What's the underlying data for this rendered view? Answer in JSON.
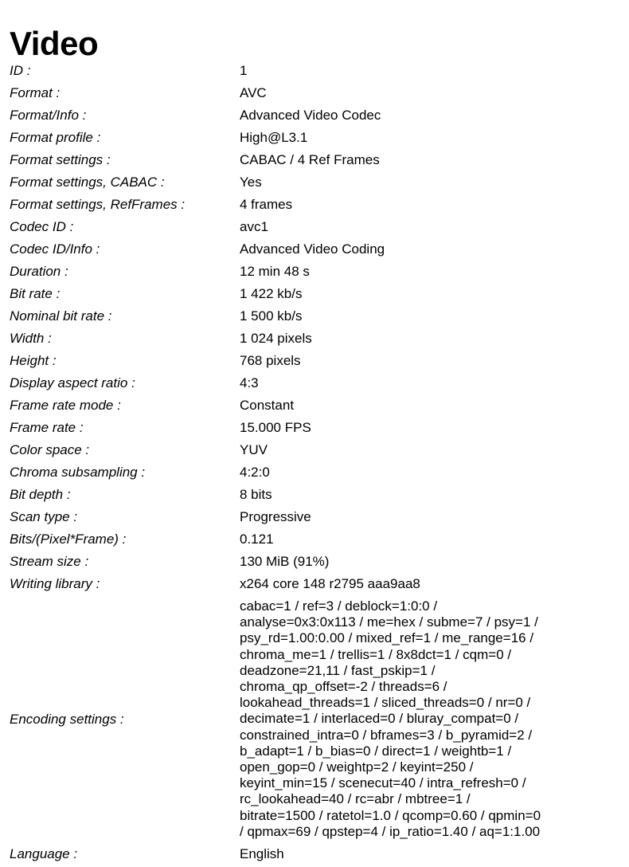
{
  "document": {
    "section_title": "Video"
  },
  "properties": [
    {
      "label": "ID :",
      "value": "1"
    },
    {
      "label": "Format :",
      "value": "AVC"
    },
    {
      "label": "Format/Info :",
      "value": "Advanced Video Codec"
    },
    {
      "label": "Format profile :",
      "value": "High@L3.1"
    },
    {
      "label": "Format settings :",
      "value": "CABAC / 4 Ref Frames"
    },
    {
      "label": "Format settings, CABAC :",
      "value": "Yes"
    },
    {
      "label": "Format settings, RefFrames :",
      "value": "4 frames"
    },
    {
      "label": "Codec ID :",
      "value": "avc1"
    },
    {
      "label": "Codec ID/Info :",
      "value": "Advanced Video Coding"
    },
    {
      "label": "Duration :",
      "value": "12 min 48 s"
    },
    {
      "label": "Bit rate :",
      "value": "1 422 kb/s"
    },
    {
      "label": "Nominal bit rate :",
      "value": "1 500 kb/s"
    },
    {
      "label": "Width :",
      "value": "1 024 pixels"
    },
    {
      "label": "Height :",
      "value": "768 pixels"
    },
    {
      "label": "Display aspect ratio :",
      "value": "4:3"
    },
    {
      "label": "Frame rate mode :",
      "value": "Constant"
    },
    {
      "label": "Frame rate :",
      "value": "15.000 FPS"
    },
    {
      "label": "Color space :",
      "value": "YUV"
    },
    {
      "label": "Chroma subsampling :",
      "value": "4:2:0"
    },
    {
      "label": "Bit depth :",
      "value": "8 bits"
    },
    {
      "label": "Scan type :",
      "value": "Progressive"
    },
    {
      "label": "Bits/(Pixel*Frame) :",
      "value": "0.121"
    },
    {
      "label": "Stream size :",
      "value": "130 MiB (91%)"
    },
    {
      "label": "Writing library :",
      "value": "x264 core 148 r2795 aaa9aa8"
    }
  ],
  "encoding": {
    "label": "Encoding settings :",
    "value": "cabac=1 / ref=3 / deblock=1:0:0 /\nanalyse=0x3:0x113 / me=hex / subme=7 / psy=1 /\npsy_rd=1.00:0.00 / mixed_ref=1 / me_range=16 /\nchroma_me=1 / trellis=1 / 8x8dct=1 / cqm=0 /\ndeadzone=21,11 / fast_pskip=1 /\nchroma_qp_offset=-2 / threads=6 /\nlookahead_threads=1 / sliced_threads=0 / nr=0 /\ndecimate=1 / interlaced=0 / bluray_compat=0 /\nconstrained_intra=0 / bframes=3 / b_pyramid=2 /\nb_adapt=1 / b_bias=0 / direct=1 / weightb=1 /\nopen_gop=0 / weightp=2 / keyint=250 /\nkeyint_min=15 / scenecut=40 / intra_refresh=0 /\nrc_lookahead=40 / rc=abr / mbtree=1 /\nbitrate=1500 / ratetol=1.0 / qcomp=0.60 / qpmin=0\n/ qpmax=69 / qpstep=4 / ip_ratio=1.40 / aq=1:1.00"
  },
  "footer": {
    "label": "Language :",
    "value": "English"
  }
}
